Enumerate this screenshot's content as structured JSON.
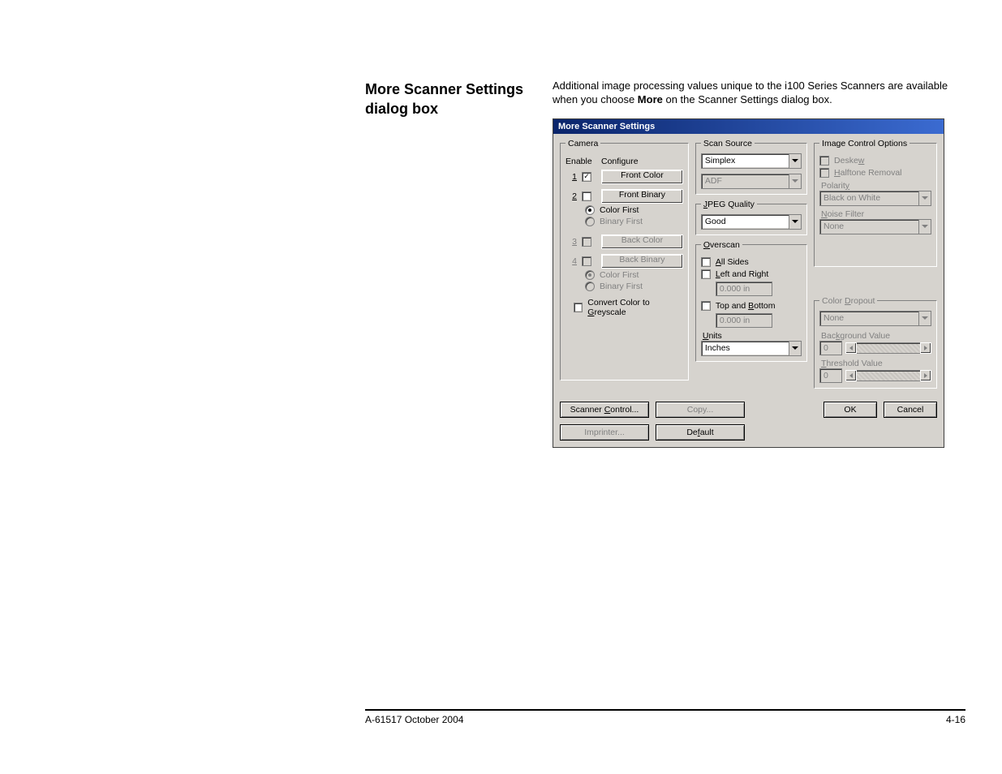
{
  "heading": "More Scanner Settings dialog box",
  "body_text_leading": "Additional image processing values unique to the i100 Series Scanners are available when you choose ",
  "body_text_bold": "More",
  "body_text_trailing": " on the Scanner Settings dialog box.",
  "dialog": {
    "title": "More Scanner Settings",
    "camera": {
      "legend": "Camera",
      "hdr_enable": "Enable",
      "hdr_configure": "Configure",
      "row1_num": "1",
      "row1_label": "Front Color",
      "row2_num": "2",
      "row2_label": "Front Binary",
      "front_color_first": "Color First",
      "front_binary_first": "Binary First",
      "row3_num": "3",
      "row3_label": "Back Color",
      "row4_num": "4",
      "row4_label": "Back Binary",
      "back_color_first": "Color First",
      "back_binary_first": "Binary First",
      "convert": "Convert Color to Greyscale"
    },
    "scan_source": {
      "legend": "Scan Source",
      "mode": "Simplex",
      "feeder": "ADF"
    },
    "jpeg": {
      "legend": "JPEG Quality",
      "value": "Good"
    },
    "overscan": {
      "legend": "Overscan",
      "all_sides": "All Sides",
      "left_right": "Left and Right",
      "lr_val": "0.000 in",
      "top_bottom": "Top and Bottom",
      "tb_val": "0.000 in",
      "units_label": "Units",
      "units_value": "Inches"
    },
    "image_ctrl": {
      "legend": "Image Control Options",
      "deskew": "Deskew",
      "halftone": "Halftone Removal",
      "polarity_label": "Polarity",
      "polarity_value": "Black on White",
      "noise_label": "Noise Filter",
      "noise_value": "None"
    },
    "color_dropout": {
      "legend": "Color Dropout",
      "value": "None",
      "bg_label": "Background Value",
      "bg_val": "0",
      "thresh_label": "Threshold Value",
      "thresh_val": "0"
    },
    "buttons": {
      "scanner_control": "Scanner Control...",
      "copy": "Copy...",
      "imprinter": "Imprinter...",
      "default": "Default",
      "ok": "OK",
      "cancel": "Cancel"
    }
  },
  "footer": {
    "left": "A-61517 October 2004",
    "right": "4-16"
  }
}
